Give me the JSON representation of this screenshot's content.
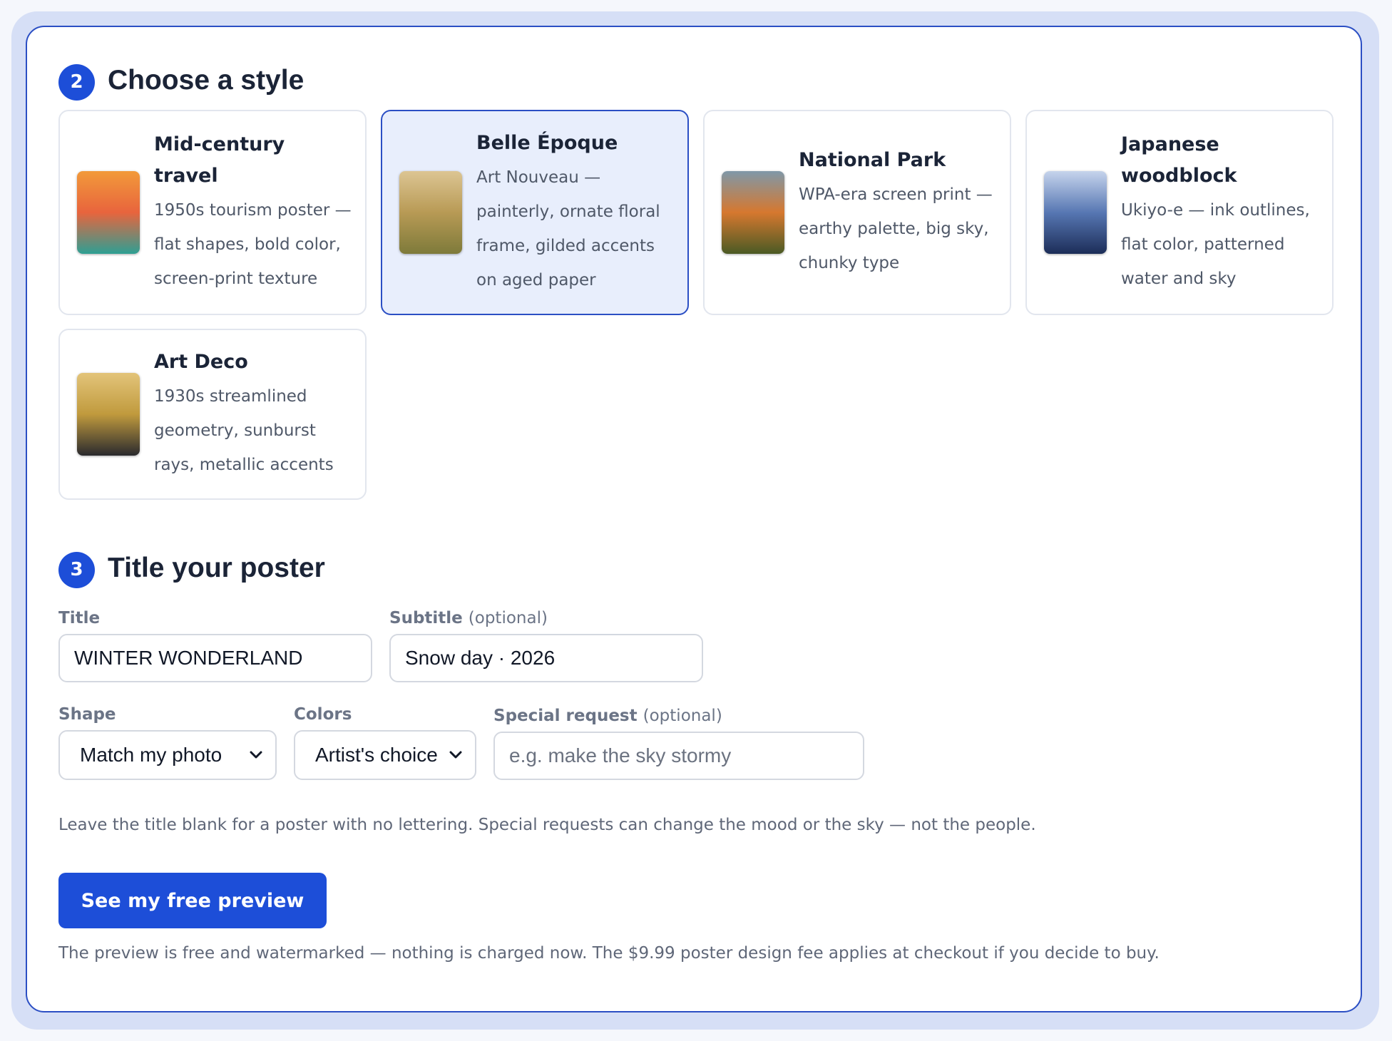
{
  "steps": {
    "style": {
      "number": "2",
      "title": "Choose a style"
    },
    "title": {
      "number": "3",
      "title": "Title your poster"
    }
  },
  "styles": [
    {
      "name": "Mid-century travel",
      "desc": "1950s tourism poster — flat shapes, bold color, screen-print texture",
      "selected": false,
      "swatch": [
        "#f29a3a",
        "#e8643d",
        "#2e9f93"
      ]
    },
    {
      "name": "Belle Époque",
      "desc": "Art Nouveau — painterly, ornate floral frame, gilded accents on aged paper",
      "selected": true,
      "swatch": [
        "#dcc593",
        "#b89a55",
        "#7e7a3a"
      ]
    },
    {
      "name": "National Park",
      "desc": "WPA-era screen print — earthy palette, big sky, chunky type",
      "selected": false,
      "swatch": [
        "#7f98a8",
        "#d6782f",
        "#4a5a24"
      ]
    },
    {
      "name": "Japanese woodblock",
      "desc": "Ukiyo-e — ink outlines, flat color, patterned water and sky",
      "selected": false,
      "swatch": [
        "#c6d4ec",
        "#5777b3",
        "#1c2d58"
      ]
    },
    {
      "name": "Art Deco",
      "desc": "1930s streamlined geometry, sunburst rays, metallic accents",
      "selected": false,
      "swatch": [
        "#e3c47a",
        "#c09a3d",
        "#2a2a2e"
      ]
    }
  ],
  "form": {
    "title_label": "Title",
    "title_value": "WINTER WONDERLAND",
    "subtitle_label": "Subtitle",
    "subtitle_optional": "(optional)",
    "subtitle_value": "Snow day · 2026",
    "shape_label": "Shape",
    "shape_value": "Match my photo",
    "colors_label": "Colors",
    "colors_value": "Artist's choice",
    "request_label": "Special request",
    "request_optional": "(optional)",
    "request_placeholder": "e.g. make the sky stormy",
    "hint": "Leave the title blank for a poster with no lettering. Special requests can change the mood or the sky — not the people."
  },
  "cta": {
    "label": "See my free preview",
    "note": "The preview is free and watermarked — nothing is charged now. The $9.99 poster design fee applies at checkout if you decide to buy."
  },
  "colors": {
    "accent": "#1d4ed8",
    "selected_bg": "#e8eefc",
    "panel_border": "#2b4fc4",
    "frame_bg": "#d6dff6"
  }
}
